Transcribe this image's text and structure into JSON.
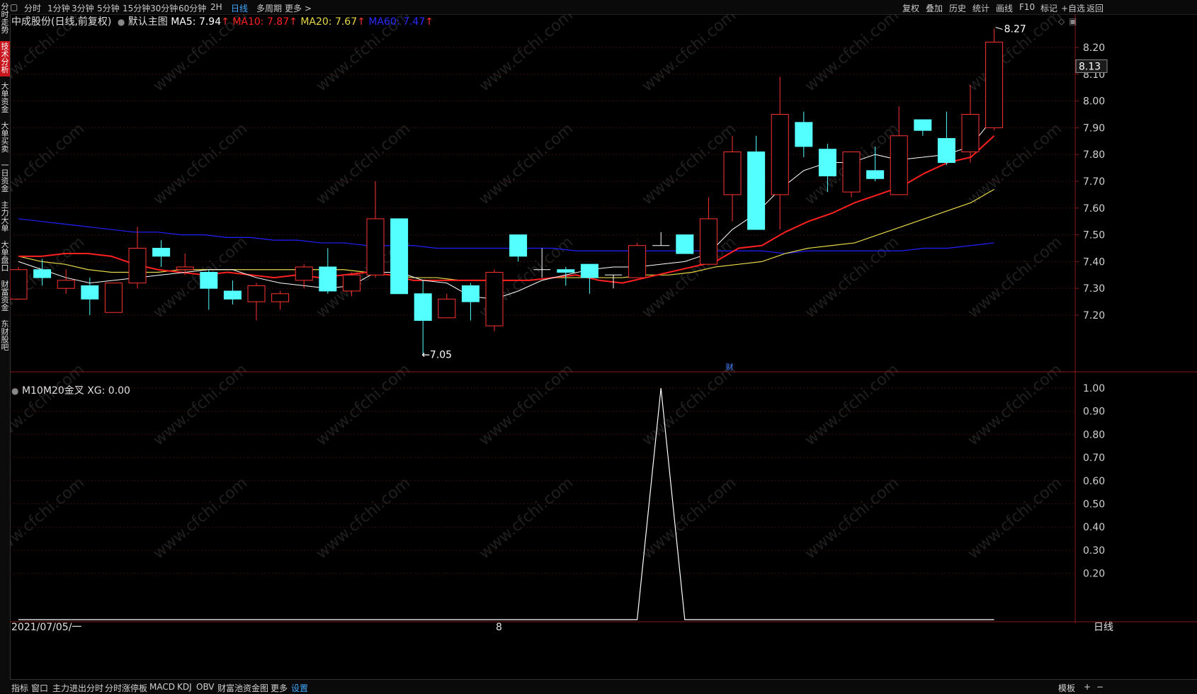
{
  "topbar": {
    "left_items": [
      "分时",
      "1分钟",
      "3分钟",
      "5分钟",
      "15分钟",
      "30分钟",
      "60分钟",
      "2H",
      "日线",
      "多周期",
      "更多 >"
    ],
    "active_item": "日线",
    "right_items": [
      "复权",
      "叠加",
      "历史",
      "统计",
      "画线",
      "F10",
      "标记",
      "+自选",
      "返回"
    ]
  },
  "sidebar": {
    "items": [
      "分时走势",
      "技术分析",
      "大单资金",
      "大单买卖",
      "一日资金",
      "主力大单",
      "大单盘口",
      "财富资金",
      "东财股吧"
    ],
    "active_item": "技术分析"
  },
  "main_legend": {
    "stock_name": "中成股份(日线,前复权)",
    "template": "默认主图",
    "ma5_text": "MA5: 7.94",
    "ma10_text": "MA10: 7.87",
    "ma20_text": "MA20: 7.67",
    "ma60_text": "MA60: 7.47",
    "arrow": "↑"
  },
  "sub_legend": {
    "indicator": "M10M20金叉",
    "value_text": "XG: 0.00"
  },
  "annotations": {
    "high_label": "8.27",
    "low_label": "←7.05",
    "price_tag": "8.13",
    "fin_marker": "财",
    "start_date": "2021/07/05/一",
    "month_marker": "8",
    "period_label": "日线"
  },
  "watermark": "www.cfchi.com",
  "bottombar": {
    "items": [
      "指标",
      "窗口",
      "主力进出分时",
      "分时涨停板",
      "MACD",
      "KDJ",
      "OBV",
      "财富池资金图",
      "更多",
      "设置"
    ],
    "active_item": "设置",
    "right_items": [
      "模板",
      "+",
      "−"
    ]
  },
  "colors": {
    "up": "#ff3232",
    "down": "#54ffff",
    "ma5": "#ffffff",
    "ma10": "#ff2020",
    "ma20": "#e8d84a",
    "ma60": "#2020ff",
    "grid": "#3a0d0d",
    "axis": "#8a1a1a"
  },
  "chart_data": [
    {
      "type": "candlestick",
      "title": "中成股份(日线,前复权)",
      "yaxis_ticks": [
        7.2,
        7.3,
        7.4,
        7.5,
        7.6,
        7.7,
        7.8,
        7.9,
        8.0,
        8.1,
        8.2
      ],
      "ylim": [
        7.03,
        8.3
      ],
      "candles": [
        {
          "o": 7.26,
          "h": 7.38,
          "l": 7.26,
          "c": 7.37
        },
        {
          "o": 7.37,
          "h": 7.41,
          "l": 7.31,
          "c": 7.34
        },
        {
          "o": 7.3,
          "h": 7.37,
          "l": 7.28,
          "c": 7.33
        },
        {
          "o": 7.31,
          "h": 7.34,
          "l": 7.2,
          "c": 7.26
        },
        {
          "o": 7.21,
          "h": 7.32,
          "l": 7.21,
          "c": 7.32
        },
        {
          "o": 7.32,
          "h": 7.53,
          "l": 7.3,
          "c": 7.45
        },
        {
          "o": 7.45,
          "h": 7.48,
          "l": 7.38,
          "c": 7.42
        },
        {
          "o": 7.37,
          "h": 7.43,
          "l": 7.35,
          "c": 7.38
        },
        {
          "o": 7.36,
          "h": 7.37,
          "l": 7.22,
          "c": 7.3
        },
        {
          "o": 7.29,
          "h": 7.33,
          "l": 7.24,
          "c": 7.26
        },
        {
          "o": 7.25,
          "h": 7.32,
          "l": 7.18,
          "c": 7.31
        },
        {
          "o": 7.25,
          "h": 7.29,
          "l": 7.22,
          "c": 7.28
        },
        {
          "o": 7.33,
          "h": 7.39,
          "l": 7.3,
          "c": 7.38
        },
        {
          "o": 7.38,
          "h": 7.45,
          "l": 7.28,
          "c": 7.29
        },
        {
          "o": 7.29,
          "h": 7.36,
          "l": 7.27,
          "c": 7.35
        },
        {
          "o": 7.35,
          "h": 7.7,
          "l": 7.34,
          "c": 7.56
        },
        {
          "o": 7.56,
          "h": 7.56,
          "l": 7.28,
          "c": 7.28
        },
        {
          "o": 7.28,
          "h": 7.33,
          "l": 7.05,
          "c": 7.18
        },
        {
          "o": 7.19,
          "h": 7.28,
          "l": 7.19,
          "c": 7.26
        },
        {
          "o": 7.31,
          "h": 7.32,
          "l": 7.18,
          "c": 7.25
        },
        {
          "o": 7.16,
          "h": 7.37,
          "l": 7.14,
          "c": 7.36
        },
        {
          "o": 7.5,
          "h": 7.5,
          "l": 7.4,
          "c": 7.42
        },
        {
          "o": 7.37,
          "h": 7.45,
          "l": 7.34,
          "c": 7.37
        },
        {
          "o": 7.37,
          "h": 7.38,
          "l": 7.31,
          "c": 7.36
        },
        {
          "o": 7.39,
          "h": 7.39,
          "l": 7.28,
          "c": 7.34
        },
        {
          "o": 7.35,
          "h": 7.35,
          "l": 7.3,
          "c": 7.35
        },
        {
          "o": 7.34,
          "h": 7.47,
          "l": 7.34,
          "c": 7.46
        },
        {
          "o": 7.46,
          "h": 7.51,
          "l": 7.46,
          "c": 7.46
        },
        {
          "o": 7.5,
          "h": 7.5,
          "l": 7.43,
          "c": 7.43
        },
        {
          "o": 7.39,
          "h": 7.64,
          "l": 7.39,
          "c": 7.56
        },
        {
          "o": 7.65,
          "h": 7.87,
          "l": 7.55,
          "c": 7.81
        },
        {
          "o": 7.81,
          "h": 7.87,
          "l": 7.53,
          "c": 7.52
        },
        {
          "o": 7.65,
          "h": 8.09,
          "l": 7.52,
          "c": 7.95
        },
        {
          "o": 7.92,
          "h": 7.96,
          "l": 7.79,
          "c": 7.83
        },
        {
          "o": 7.82,
          "h": 7.84,
          "l": 7.66,
          "c": 7.72
        },
        {
          "o": 7.66,
          "h": 7.81,
          "l": 7.64,
          "c": 7.81
        },
        {
          "o": 7.74,
          "h": 7.83,
          "l": 7.7,
          "c": 7.71
        },
        {
          "o": 7.65,
          "h": 7.98,
          "l": 7.65,
          "c": 7.87
        },
        {
          "o": 7.93,
          "h": 7.93,
          "l": 7.87,
          "c": 7.89
        },
        {
          "o": 7.86,
          "h": 7.96,
          "l": 7.76,
          "c": 7.77
        },
        {
          "o": 7.81,
          "h": 8.06,
          "l": 7.77,
          "c": 7.95
        },
        {
          "o": 7.9,
          "h": 8.27,
          "l": 7.89,
          "c": 8.22
        }
      ],
      "ma5": [
        7.4,
        7.37,
        7.34,
        7.32,
        7.33,
        7.34,
        7.35,
        7.36,
        7.37,
        7.37,
        7.34,
        7.32,
        7.31,
        7.3,
        7.31,
        7.36,
        7.36,
        7.33,
        7.32,
        7.27,
        7.26,
        7.29,
        7.33,
        7.35,
        7.37,
        7.38,
        7.38,
        7.39,
        7.4,
        7.43,
        7.52,
        7.58,
        7.67,
        7.74,
        7.77,
        7.77,
        7.8,
        7.78,
        7.79,
        7.8,
        7.83,
        7.94
      ],
      "ma10": [
        7.42,
        7.42,
        7.43,
        7.43,
        7.42,
        7.39,
        7.37,
        7.36,
        7.35,
        7.36,
        7.35,
        7.34,
        7.35,
        7.34,
        7.35,
        7.36,
        7.35,
        7.33,
        7.33,
        7.33,
        7.33,
        7.33,
        7.33,
        7.34,
        7.35,
        7.33,
        7.32,
        7.34,
        7.36,
        7.38,
        7.4,
        7.45,
        7.46,
        7.51,
        7.55,
        7.58,
        7.62,
        7.65,
        7.68,
        7.73,
        7.77,
        7.79,
        7.87
      ],
      "ma20": [
        7.42,
        7.4,
        7.39,
        7.37,
        7.36,
        7.36,
        7.36,
        7.37,
        7.37,
        7.37,
        7.37,
        7.37,
        7.37,
        7.37,
        7.37,
        7.36,
        7.35,
        7.34,
        7.34,
        7.33,
        7.33,
        7.33,
        7.33,
        7.34,
        7.34,
        7.34,
        7.34,
        7.35,
        7.35,
        7.36,
        7.38,
        7.39,
        7.4,
        7.43,
        7.45,
        7.46,
        7.47,
        7.5,
        7.53,
        7.56,
        7.59,
        7.62,
        7.67
      ],
      "ma60": [
        7.56,
        7.55,
        7.54,
        7.53,
        7.52,
        7.51,
        7.51,
        7.5,
        7.5,
        7.49,
        7.49,
        7.48,
        7.48,
        7.47,
        7.47,
        7.46,
        7.46,
        7.46,
        7.45,
        7.45,
        7.45,
        7.45,
        7.45,
        7.45,
        7.44,
        7.44,
        7.44,
        7.44,
        7.44,
        7.44,
        7.44,
        7.44,
        7.44,
        7.43,
        7.44,
        7.44,
        7.44,
        7.44,
        7.44,
        7.45,
        7.45,
        7.46,
        7.47
      ]
    },
    {
      "type": "line",
      "title": "M10M20金叉",
      "series": [
        {
          "name": "XG",
          "values": [
            0,
            0,
            0,
            0,
            0,
            0,
            0,
            0,
            0,
            0,
            0,
            0,
            0,
            0,
            0,
            0,
            0,
            0,
            0,
            0,
            0,
            0,
            0,
            0,
            0,
            0,
            0,
            1,
            0,
            0,
            0,
            0,
            0,
            0,
            0,
            0,
            0,
            0,
            0,
            0,
            0,
            0
          ]
        }
      ],
      "yaxis_ticks": [
        0.2,
        0.3,
        0.4,
        0.5,
        0.6,
        0.7,
        0.8,
        0.9,
        1.0
      ],
      "ylim": [
        0,
        1.0
      ]
    }
  ]
}
